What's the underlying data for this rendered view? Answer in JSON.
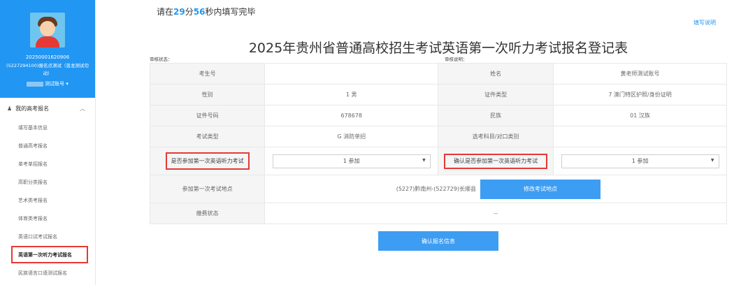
{
  "sidebar": {
    "user_id": "20250001620906",
    "org": "(5227294100)报名点测试（普龙测试勿动）",
    "account_label": "测试账号",
    "group_label": "我的高考报名",
    "items": [
      {
        "label": "填写基本信息"
      },
      {
        "label": "普通高考报名"
      },
      {
        "label": "单考单招报名"
      },
      {
        "label": "高职分类报名"
      },
      {
        "label": "艺术类考报名"
      },
      {
        "label": "体育类考报名"
      },
      {
        "label": "英语口试考试报名"
      },
      {
        "label": "英语第一次听力考试报名"
      },
      {
        "label": "民族语言口语测试报名"
      }
    ]
  },
  "timer": {
    "prefix": "请在",
    "minutes": "29",
    "min_unit": "分",
    "seconds": "56",
    "suffix": "秒内填写完毕"
  },
  "help_link": "填写说明",
  "title": "2025年贵州省普通高校招生考试英语第一次听力考试报名登记表",
  "status": {
    "left": "审核状态：",
    "right": "审核说明："
  },
  "form": {
    "exam_no_label": "考生号",
    "exam_no": "",
    "name_label": "姓名",
    "name": "黄老师测试账号",
    "gender_label": "性别",
    "gender": "1 男",
    "id_type_label": "证件类型",
    "id_type": "7 澳门特区护照/身份证明",
    "id_no_label": "证件号码",
    "id_no": "678678",
    "ethnic_label": "民族",
    "ethnic": "01 汉族",
    "exam_type_label": "考试类型",
    "exam_type": "G 消防单招",
    "subject_label": "选考科目/对口类别",
    "subject": "",
    "join_label": "是否参加第一次英语听力考试",
    "join_value": "1 参加",
    "confirm_join_label": "确认是否参加第一次英语听力考试",
    "confirm_join_value": "1 参加",
    "location_label": "参加第一次考试地点",
    "location": "(5227)黔南州-(522729)长顺县",
    "modify_btn": "修改考试地点",
    "fee_label": "缴费状态",
    "fee": "--"
  },
  "confirm_button": "确认报名信息",
  "colors": {
    "primary": "#2196f3",
    "highlight_border": "#e53935"
  }
}
